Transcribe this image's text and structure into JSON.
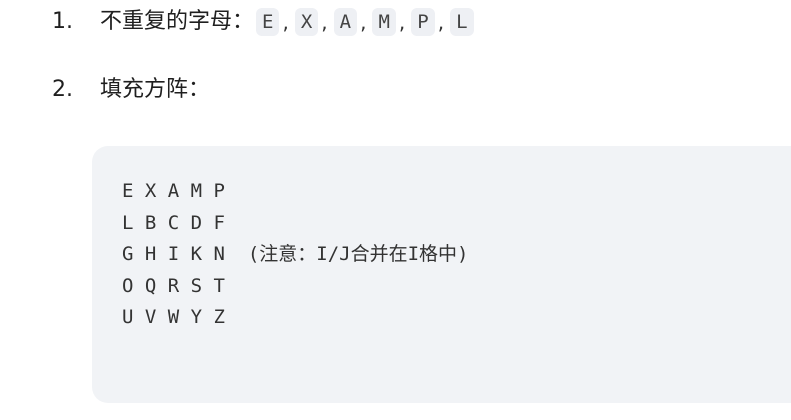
{
  "list": {
    "item1": {
      "number": "1.",
      "label": "不重复的字母：",
      "letters": [
        "E",
        "X",
        "A",
        "M",
        "P",
        "L"
      ],
      "separator": ","
    },
    "item2": {
      "number": "2.",
      "label": "填充方阵："
    }
  },
  "code_block": {
    "lines": [
      "E X A M P",
      "L B C D F",
      "G H I K N  (注意：I/J合并在I格中)",
      "O Q R S T",
      "U V W Y Z"
    ]
  }
}
